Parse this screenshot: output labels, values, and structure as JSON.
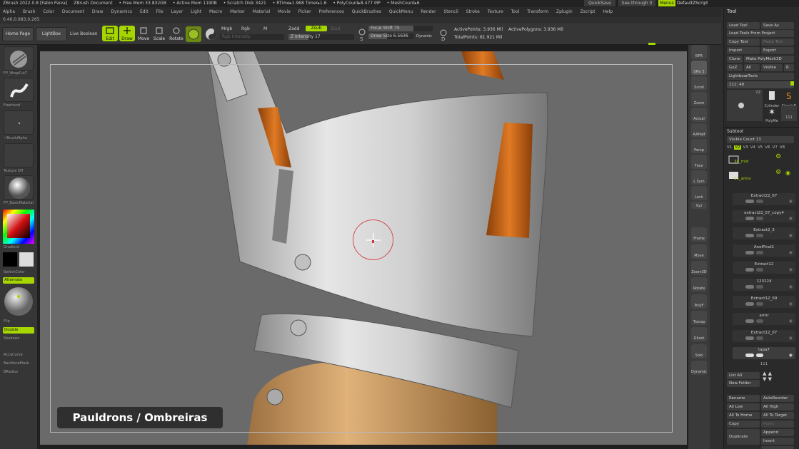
{
  "titlebar": {
    "items": [
      "ZBrush 2022.0.8 [Fabio Paiva]",
      "ZBrush Document",
      "• Free Mem 33.832GB",
      "• Active Mem 1190B",
      "• Scratch Disk 3421",
      "• RTime▸1.968 Timer▸1.6",
      "• PolyCount▸8.477 MP",
      "• MeshCount▸6"
    ],
    "quicksave": "QuickSave",
    "seethrough": "See-through 0",
    "menus": "Menus",
    "defaultzscript": "DefaultZScript"
  },
  "menubar": {
    "items": [
      "Alpha",
      "Brush",
      "Color",
      "Document",
      "Draw",
      "Dynamics",
      "Edit",
      "File",
      "Layer",
      "Light",
      "Macro",
      "Marker",
      "Material",
      "Movie",
      "Picker",
      "Preferences",
      "QuickBrushes",
      "QuickMenu",
      "Render",
      "Stencil",
      "Stroke",
      "Texture",
      "Tool",
      "Transform",
      "Zplugin",
      "Zscript",
      "Help"
    ]
  },
  "coords": "0.46,0.983,0.265",
  "toolbar": {
    "home_page": "Home Page",
    "lightbox": "LightBox",
    "live_boolean": "Live Boolean",
    "edit": "Edit",
    "draw": "Draw",
    "move": "Move",
    "scale": "Scale",
    "rotate": "Rotate",
    "mrgb": "Mrgb",
    "rgb": "Rgb",
    "m": "M",
    "rgb_intensity": "Rgb Intensity",
    "zadd": "Zadd",
    "zsub": "Zsub",
    "zcut": "Zcut",
    "z_intensity": "Z Intensity 17",
    "focal_shift": "Focal Shift 75",
    "draw_size": "Draw Size 6.5636",
    "dynamic": "Dynamic",
    "active_points": "ActivePoints: 3.936 Mil",
    "total_points": "TotalPoints: 81.921 Mil",
    "active_polygons": "ActivePolygons: 3.936 Mil"
  },
  "left_shelf": {
    "brush_label": "FP_WrapCut7",
    "stroke_label": "Freehand",
    "alpha_label": "~BrushAlpha",
    "texture_label": "Texture Off",
    "material_label": "FP_BasicMaterial",
    "gradient": "Gradient",
    "switchcolor": "SwitchColor",
    "alternate": "Alternate",
    "flip": "Flip",
    "double": "Double",
    "shadows": "Shadows",
    "accucurve": "AccuCurve",
    "backface": "BackfaceMask",
    "bradius": "BRadius"
  },
  "right_shelf": [
    "BPR",
    "SPix 3",
    "Scroll",
    "Zoom",
    "Actual",
    "AAHalf",
    "Persp",
    "Floor",
    "L.Sym",
    "Lock",
    "Xyz",
    "Frame",
    "Move",
    "Zoom3D",
    "Rotate",
    "PolyF",
    "Transp",
    "Ghost",
    "Solo",
    "Dynamic"
  ],
  "tool_panel": {
    "title": "Tool",
    "load_tool": "Load Tool",
    "save_as": "Save As",
    "load_from_project": "Load Tools From Project",
    "copy_tool": "Copy Tool",
    "paste_tool": "Paste Tool",
    "import": "Import",
    "export": "Export",
    "clone": "Clone",
    "make_polymesh": "Make PolyMesh3D",
    "goz": "GoZ",
    "all": "All",
    "visible": "Visible",
    "r": "R",
    "lightbox_tools": "Lightbox▸Tools",
    "tool_name": "111: 48",
    "thumb_count": "72",
    "cylinder": "Cylinder",
    "simple": "SimpleB",
    "polymesh": "PolyMe",
    "tool_111": "111",
    "subtool_title": "Subtool",
    "visible_count": "Visible Count 13",
    "v_tabs": [
      "V1",
      "V2",
      "V3",
      "V4",
      "V5",
      "V6",
      "V7",
      "V8"
    ],
    "folder_1": "38_mid",
    "folder_2": "15_arms",
    "subtools": [
      "Extract22_07",
      "extract22_07_copy4",
      "Extract2_3",
      "AnelFinal1",
      "Extract12",
      "123124",
      "Extract12_09",
      "armr",
      "Extract12_07",
      "tapa7",
      "111"
    ],
    "list_all": "List All",
    "new_folder": "New Folder",
    "rename": "Rename",
    "autoreorder": "AutoReorder",
    "all_low": "All Low",
    "all_high": "All High",
    "all_to_home": "All To Home",
    "all_to_target": "All To Target",
    "copy": "Copy",
    "paste": "Paste",
    "duplicate": "Duplicate",
    "append": "Append",
    "insert": "Insert",
    "del_other": "Del Other"
  },
  "caption": "Pauldrons / Ombreiras",
  "colors": {
    "accent": "#a6d600",
    "canvas": "#6a6a6a",
    "leather": "#c8651a",
    "gold": "#c89a5a"
  }
}
